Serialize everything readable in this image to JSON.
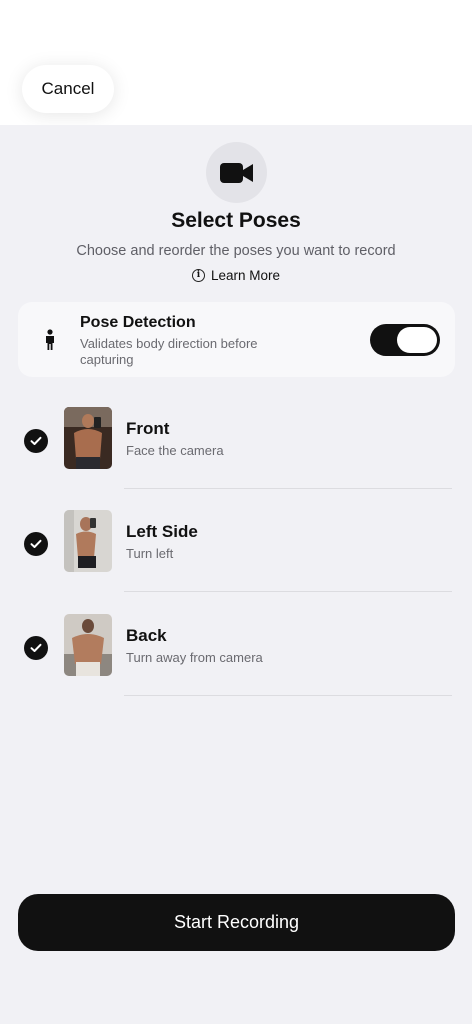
{
  "header": {
    "cancel_label": "Cancel"
  },
  "icons": {
    "header_icon": "video-camera-icon",
    "info": "info-icon",
    "detection": "person-icon",
    "check": "checkmark-icon"
  },
  "main": {
    "title": "Select Poses",
    "subtitle": "Choose and reorder the poses you want to record",
    "learn_more": "Learn More"
  },
  "pose_detection": {
    "title": "Pose Detection",
    "description": "Validates body direction before capturing",
    "enabled": true
  },
  "poses": [
    {
      "name": "Front",
      "description": "Face the camera",
      "selected": true
    },
    {
      "name": "Left Side",
      "description": "Turn left",
      "selected": true
    },
    {
      "name": "Back",
      "description": "Turn away from camera",
      "selected": true
    }
  ],
  "footer": {
    "start_label": "Start Recording"
  },
  "colors": {
    "primary": "#111111",
    "sheet_background": "#f1f1f5",
    "card_background": "#f8f8fa",
    "secondary_text": "#6a6a70"
  }
}
